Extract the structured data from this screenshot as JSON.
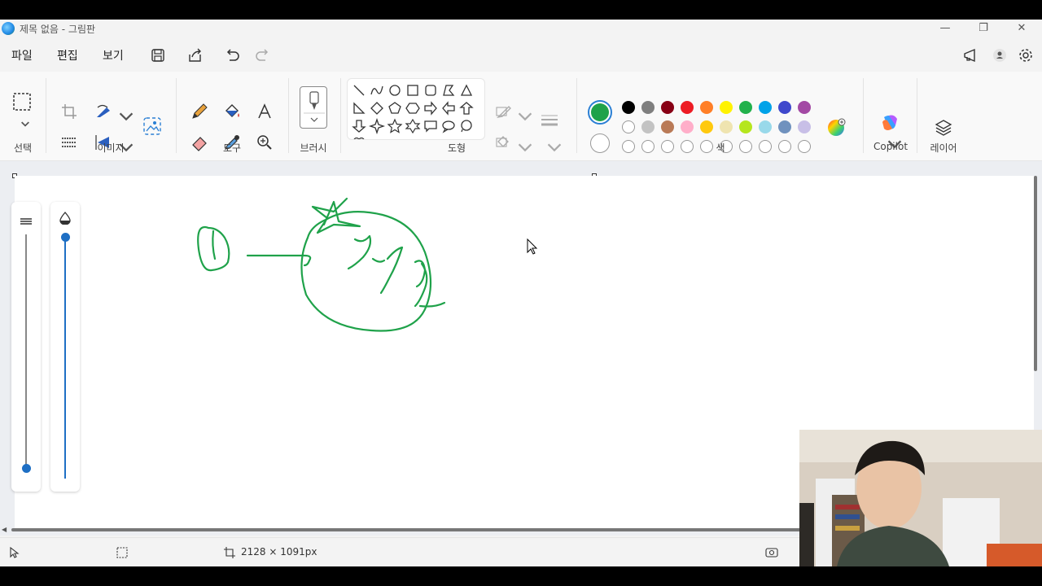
{
  "window": {
    "title": "제목 없음 - 그림판"
  },
  "menu": {
    "items": [
      "파일",
      "편집",
      "보기"
    ]
  },
  "ribbon": {
    "groups": {
      "select": "선택",
      "image": "이미지",
      "tools": "도구",
      "brush": "브러시",
      "shapes": "도형",
      "colors": "색",
      "copilot": "Copilot",
      "layers": "레이어"
    }
  },
  "colors": {
    "primary": "#1fa24a",
    "secondary": "#ffffff",
    "palette_row1": [
      "#000000",
      "#7f7f7f",
      "#880015",
      "#ed1c24",
      "#ff7f27",
      "#fff200",
      "#22b14c",
      "#00a2e8",
      "#3f48cc",
      "#a349a4"
    ],
    "palette_row2": [
      "#ffffff",
      "#c3c3c3",
      "#b97a57",
      "#ffaec9",
      "#ffc90e",
      "#efe4b0",
      "#b5e61d",
      "#99d9ea",
      "#7092be",
      "#c8bfe7"
    ],
    "palette_row3_empty_count": 10
  },
  "status": {
    "canvas_size": "2128 × 1091px"
  }
}
